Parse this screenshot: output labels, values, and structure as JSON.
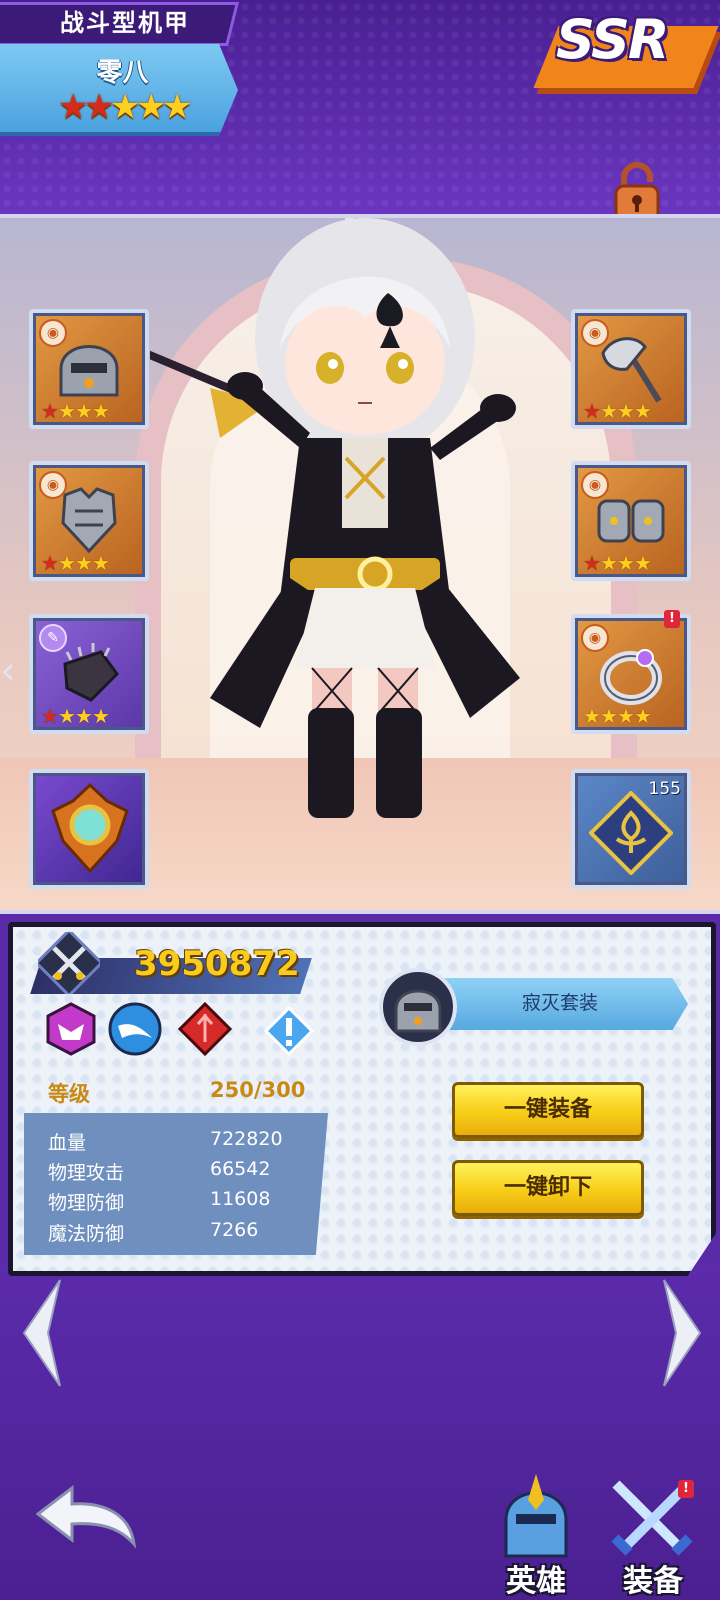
{
  "header": {
    "class_title": "战斗型机甲",
    "hero_name": "零八",
    "stars": {
      "red": 2,
      "gold": 3
    },
    "rarity": "SSR"
  },
  "equipment": {
    "left": [
      {
        "name": "helmet",
        "stars_red": 1,
        "stars_gold": 3
      },
      {
        "name": "armor",
        "stars_red": 1,
        "stars_gold": 3
      },
      {
        "name": "gauntlet",
        "stars_red": 1,
        "stars_gold": 3
      },
      {
        "name": "orb-emblem"
      }
    ],
    "right": [
      {
        "name": "axe",
        "stars_red": 1,
        "stars_gold": 3
      },
      {
        "name": "boots",
        "stars_red": 1,
        "stars_gold": 3
      },
      {
        "name": "ring",
        "stars_red": 0,
        "stars_gold": 4
      },
      {
        "name": "sigil",
        "count": "155"
      }
    ]
  },
  "info": {
    "power": "3950872",
    "level_label": "等级",
    "level_value": "250/300",
    "stats": [
      {
        "label": "血量",
        "value": "722820"
      },
      {
        "label": "物理攻击",
        "value": "66542"
      },
      {
        "label": "物理防御",
        "value": "11608"
      },
      {
        "label": "魔法防御",
        "value": "7266"
      }
    ],
    "set_name": "寂灭套装",
    "equip_all": "一键装备",
    "unequip_all": "一键卸下"
  },
  "nav": {
    "hero_tab": "英雄",
    "equip_tab": "装备"
  },
  "colors": {
    "background": "#5a2aa8",
    "power_text": "#f8cc1d",
    "button": "#f7ce17",
    "star_red": "#d52b1e",
    "star_gold": "#ffcf1f"
  }
}
